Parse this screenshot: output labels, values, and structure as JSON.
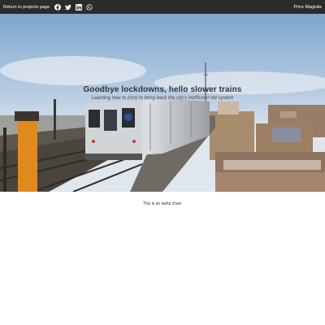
{
  "nav": {
    "back_label": "Return to projects page",
    "author": "Prinz Magtulis",
    "social_icons": [
      "facebook-icon",
      "twitter-icon",
      "linkedin-icon",
      "whatsapp-icon"
    ]
  },
  "hero": {
    "title": "Goodbye lockdowns, hello slower trains",
    "subtitle": "Learning how to (not) to bring back the city's inefficient old system"
  },
  "caption": "This is an awful chart.",
  "colors": {
    "topbar": "#2b2b2b",
    "sky": "#8fb3d8",
    "train_silver": "#c9ccd0",
    "sign_orange": "#e08a1e"
  }
}
